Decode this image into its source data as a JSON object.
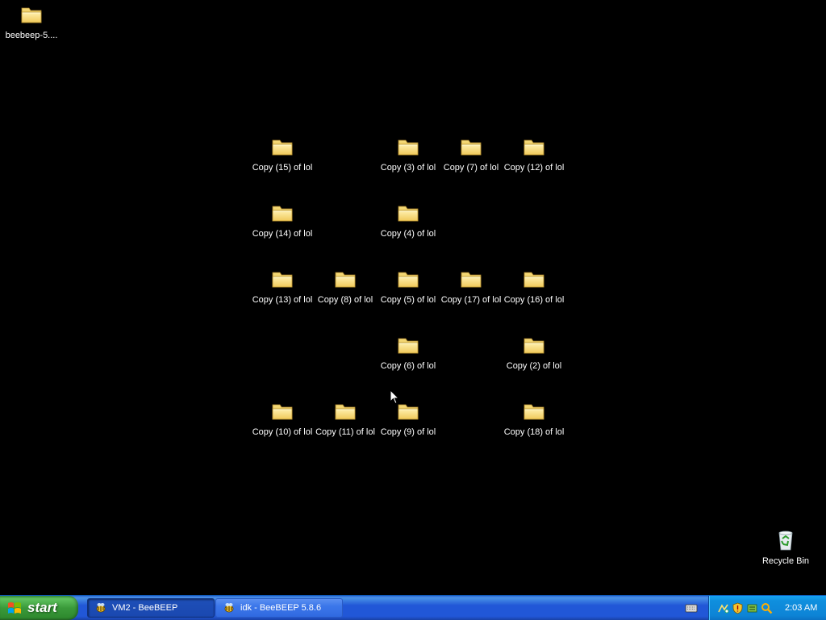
{
  "desktop": {
    "icons": [
      {
        "id": "beebeep",
        "label": "beebeep-5....",
        "type": "folder"
      },
      {
        "id": "copy15",
        "label": "Copy (15) of lol",
        "type": "folder"
      },
      {
        "id": "copy3",
        "label": "Copy (3) of lol",
        "type": "folder"
      },
      {
        "id": "copy7",
        "label": "Copy (7) of lol",
        "type": "folder"
      },
      {
        "id": "copy12",
        "label": "Copy (12) of lol",
        "type": "folder"
      },
      {
        "id": "copy14",
        "label": "Copy (14) of lol",
        "type": "folder"
      },
      {
        "id": "copy4",
        "label": "Copy (4) of lol",
        "type": "folder"
      },
      {
        "id": "copy13",
        "label": "Copy (13) of lol",
        "type": "folder"
      },
      {
        "id": "copy8",
        "label": "Copy (8) of lol",
        "type": "folder"
      },
      {
        "id": "copy5",
        "label": "Copy (5) of lol",
        "type": "folder"
      },
      {
        "id": "copy17",
        "label": "Copy (17) of lol",
        "type": "folder"
      },
      {
        "id": "copy16",
        "label": "Copy (16) of lol",
        "type": "folder"
      },
      {
        "id": "copy6",
        "label": "Copy (6) of lol",
        "type": "folder"
      },
      {
        "id": "copy2",
        "label": "Copy (2) of lol",
        "type": "folder"
      },
      {
        "id": "copy10",
        "label": "Copy (10) of lol",
        "type": "folder"
      },
      {
        "id": "copy11",
        "label": "Copy (11) of lol",
        "type": "folder"
      },
      {
        "id": "copy9",
        "label": "Copy (9) of lol",
        "type": "folder"
      },
      {
        "id": "copy18",
        "label": "Copy (18) of lol",
        "type": "folder"
      },
      {
        "id": "recycle",
        "label": "Recycle Bin",
        "type": "recycle-bin"
      }
    ]
  },
  "taskbar": {
    "start_label": "start",
    "tasks": [
      {
        "label": "VM2 - BeeBEEP",
        "state": "active",
        "icon": "beebeep-icon"
      },
      {
        "label": "idk - BeeBEEP 5.8.6",
        "state": "inactive",
        "icon": "beebeep-icon"
      }
    ],
    "tray": {
      "icons": [
        "network-icon",
        "security-shield-icon",
        "beebeep-tray-icon",
        "search-icon"
      ],
      "clock": "2:03 AM"
    }
  },
  "colors": {
    "desktop_bg": "#000000",
    "taskbar_blue": "#2157d7",
    "start_green": "#3a9a3a",
    "tray_blue": "#0f8fde",
    "folder_yellow": "#f5d66b"
  }
}
